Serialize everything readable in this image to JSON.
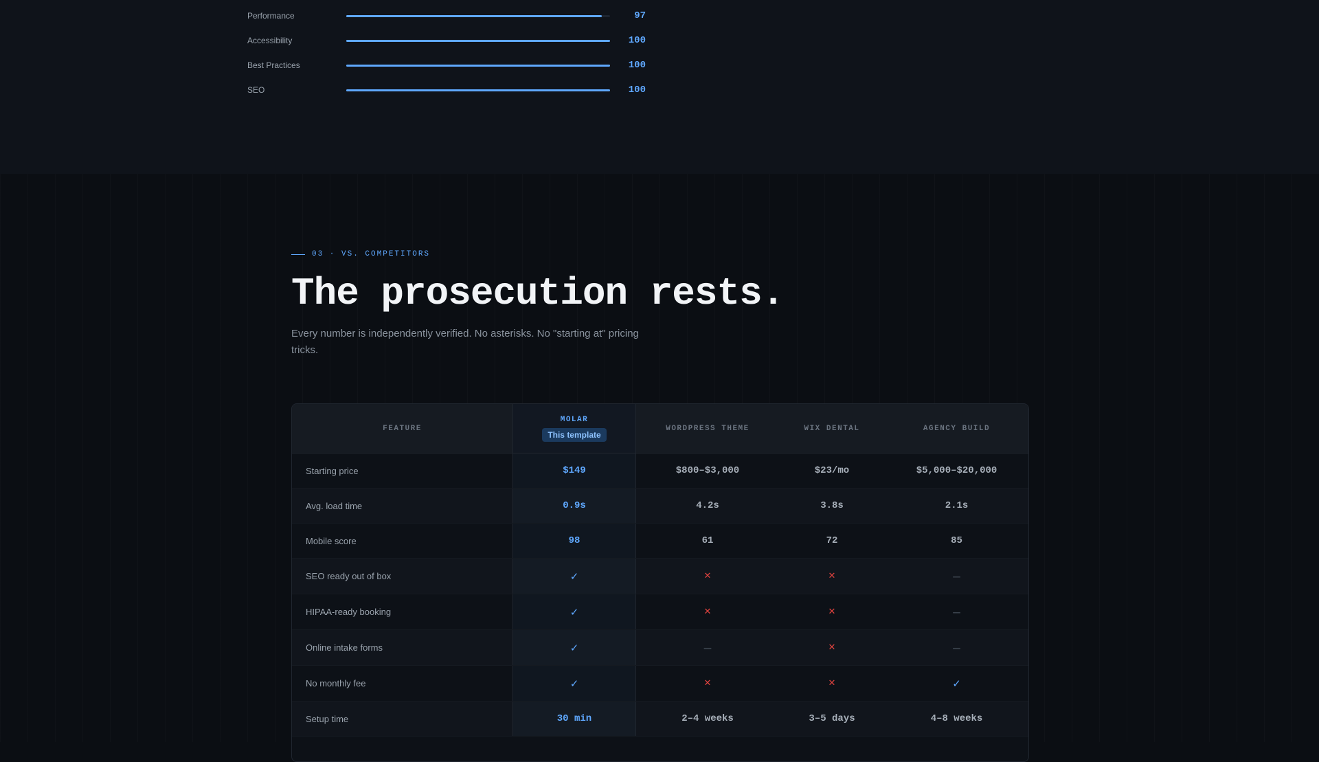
{
  "lighthouse": {
    "rows": [
      {
        "label": "Performance",
        "score": "97",
        "fraction": 0.97
      },
      {
        "label": "Accessibility",
        "score": "100",
        "fraction": 1.0
      },
      {
        "label": "Best Practices",
        "score": "100",
        "fraction": 1.0
      },
      {
        "label": "SEO",
        "score": "100",
        "fraction": 1.0
      }
    ]
  },
  "section": {
    "eyebrow": "03 · VS. COMPETITORS",
    "title": "The prosecution rests.",
    "subtitle": "Every number is independently verified. No asterisks. No \"starting at\" pricing tricks."
  },
  "table": {
    "headers": {
      "feature": "FEATURE",
      "molar": "MOLAR",
      "molar_badge": "This template",
      "wordpress": "WORDPRESS THEME",
      "wix": "WIX DENTAL",
      "agency": "AGENCY BUILD"
    },
    "rows": [
      {
        "feature": "Starting price",
        "molar": "$149",
        "wordpress": "$800–$3,000",
        "wix": "$23/mo",
        "agency": "$5,000–$20,000"
      },
      {
        "feature": "Avg. load time",
        "molar": "0.9s",
        "wordpress": "4.2s",
        "wix": "3.8s",
        "agency": "2.1s"
      },
      {
        "feature": "Mobile score",
        "molar": "98",
        "wordpress": "61",
        "wix": "72",
        "agency": "85"
      },
      {
        "feature": "SEO ready out of box",
        "molar": "check",
        "wordpress": "cross",
        "wix": "cross",
        "agency": "dash"
      },
      {
        "feature": "HIPAA-ready booking",
        "molar": "check",
        "wordpress": "cross",
        "wix": "cross",
        "agency": "dash"
      },
      {
        "feature": "Online intake forms",
        "molar": "check",
        "wordpress": "dash",
        "wix": "cross",
        "agency": "dash"
      },
      {
        "feature": "No monthly fee",
        "molar": "check",
        "wordpress": "cross",
        "wix": "cross",
        "agency": "check"
      },
      {
        "feature": "Setup time",
        "molar": "30 min",
        "wordpress": "2–4 weeks",
        "wix": "3–5 days",
        "agency": "4–8 weeks"
      }
    ]
  },
  "icons": {
    "check": "✓",
    "cross": "✕",
    "dash": "—"
  },
  "colors": {
    "accent": "#5fa8ff",
    "negative": "#e0433f",
    "background": "#0b0e13"
  }
}
